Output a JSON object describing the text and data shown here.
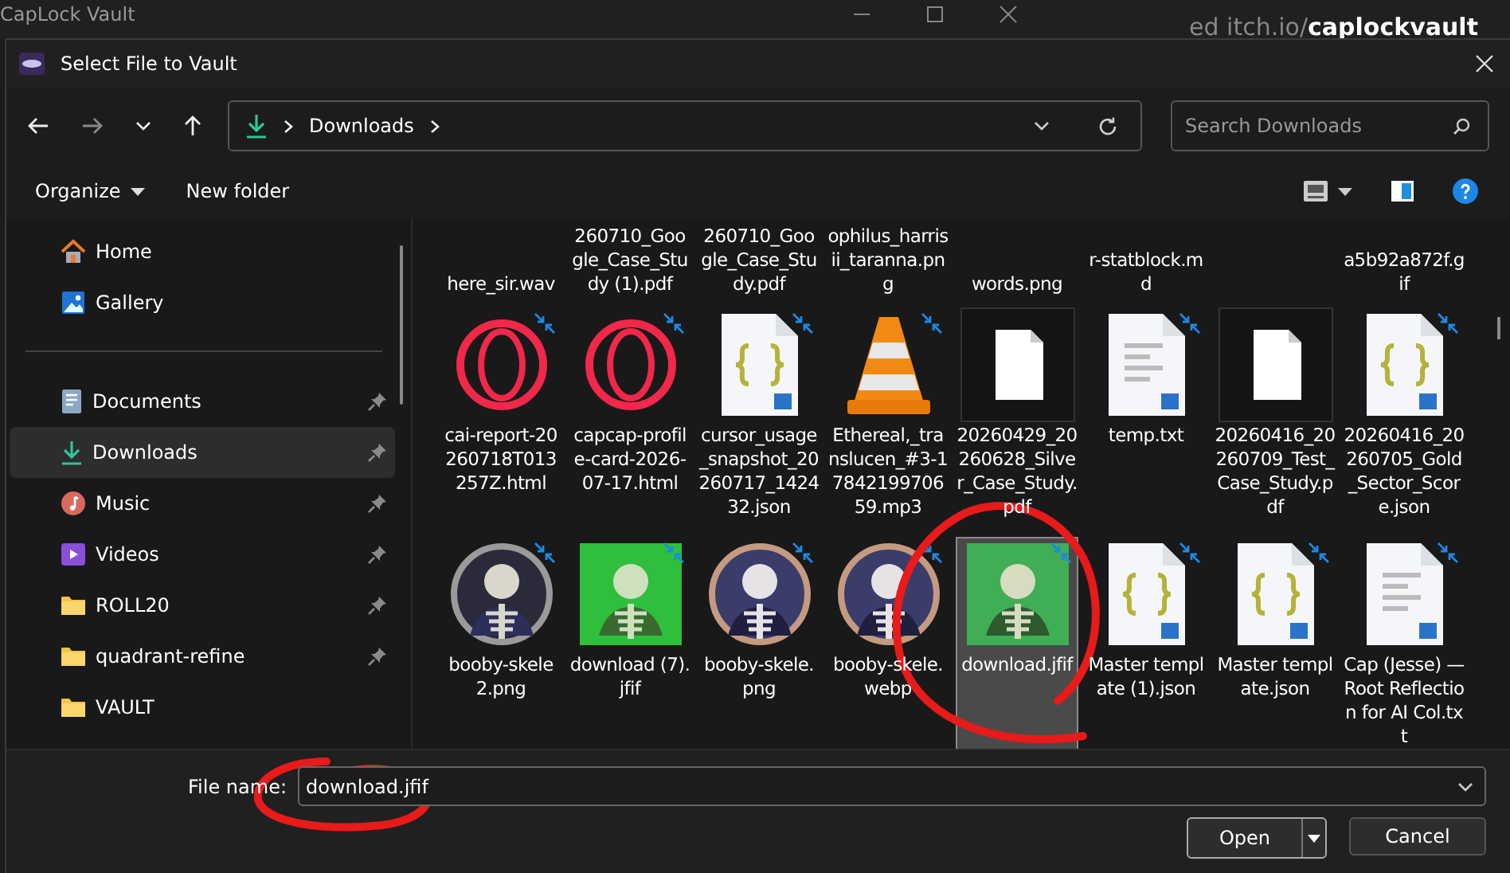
{
  "background_app": {
    "title": "CapLock Vault",
    "url": "ed itch.io/**caplockvault**"
  },
  "dialog": {
    "title": "Select File to Vault"
  },
  "address": {
    "crumbs": [
      "Downloads"
    ],
    "search_placeholder": "Search Downloads"
  },
  "commands": {
    "organize": "Organize",
    "new_folder": "New folder"
  },
  "sidebar": [
    {
      "label": "Home",
      "kind": "home",
      "pinned": false,
      "selected": false
    },
    {
      "label": "Gallery",
      "kind": "gallery",
      "pinned": false,
      "selected": false
    },
    {
      "kind": "divider"
    },
    {
      "label": "Documents",
      "kind": "documents",
      "pinned": true,
      "selected": false
    },
    {
      "label": "Downloads",
      "kind": "downloads",
      "pinned": true,
      "selected": true
    },
    {
      "label": "Music",
      "kind": "music",
      "pinned": true,
      "selected": false
    },
    {
      "label": "Videos",
      "kind": "videos",
      "pinned": true,
      "selected": false
    },
    {
      "label": "ROLL20",
      "kind": "folder",
      "pinned": true,
      "selected": false
    },
    {
      "label": "quadrant-refine",
      "kind": "folder",
      "pinned": true,
      "selected": false
    },
    {
      "label": "VAULT",
      "kind": "folder",
      "pinned": false,
      "selected": false
    }
  ],
  "partial_row": [
    {
      "kind": "name",
      "name": "here_sir.wav"
    },
    {
      "kind": "name",
      "name": "260710_Google_Case_Study (1).pdf"
    },
    {
      "kind": "name",
      "name": "260710_Google_Case_Study.pdf"
    },
    {
      "kind": "name",
      "name": "ophilus_harrisii_taranna.png"
    },
    {
      "kind": "name",
      "name": "words.png"
    },
    {
      "kind": "name",
      "name": "r-statblock.md"
    },
    {
      "kind": "unreadable"
    },
    {
      "kind": "name",
      "name": "a5b92a872f.gif"
    }
  ],
  "files": [
    {
      "name": "cai-report-20260718T013257Z.html",
      "kind": "opera",
      "shortcut": true,
      "selected": false
    },
    {
      "name": "capcap-profile-card-2026-07-17.html",
      "kind": "opera",
      "shortcut": true,
      "selected": false
    },
    {
      "name": "cursor_usage_snapshot_20260717_142432.json",
      "kind": "json",
      "shortcut": true,
      "selected": false
    },
    {
      "name": "Ethereal,_translucen_#3-1784219970659.mp3",
      "kind": "vlc",
      "shortcut": true,
      "selected": false
    },
    {
      "name": "20260429_20260628_Silver_Case_Study.pdf",
      "kind": "blank",
      "shortcut": false,
      "selected": false
    },
    {
      "name": "temp.txt",
      "kind": "text",
      "shortcut": true,
      "selected": false
    },
    {
      "name": "20260416_20260709_Test_Case_Study.pdf",
      "kind": "blank",
      "shortcut": false,
      "selected": false
    },
    {
      "name": "20260416_20260705_Gold_Sector_Score.json",
      "kind": "json",
      "shortcut": true,
      "selected": false
    },
    {
      "name": "booby-skele2.png",
      "kind": "picture",
      "shortcut": true,
      "selected": false
    },
    {
      "name": "download (7).jfif",
      "kind": "picture",
      "shortcut": true,
      "selected": false
    },
    {
      "name": "booby-skele.png",
      "kind": "picture",
      "shortcut": true,
      "selected": false
    },
    {
      "name": "booby-skele.webp",
      "kind": "picture",
      "shortcut": true,
      "selected": false
    },
    {
      "name": "download.jfif",
      "kind": "picture",
      "shortcut": true,
      "selected": true
    },
    {
      "name": "Master template (1).json",
      "kind": "json",
      "shortcut": true,
      "selected": false
    },
    {
      "name": "Master template.json",
      "kind": "json",
      "shortcut": true,
      "selected": false
    },
    {
      "name": "Cap (Jesse) — Root Reflection for AI Col.txt",
      "kind": "text",
      "shortcut": true,
      "selected": false
    }
  ],
  "file_name": {
    "label": "File name:",
    "value": "download.jfif"
  },
  "buttons": {
    "open": "Open",
    "cancel": "Cancel"
  },
  "annotations": [
    {
      "kind": "circle"
    },
    {
      "kind": "circle"
    }
  ]
}
